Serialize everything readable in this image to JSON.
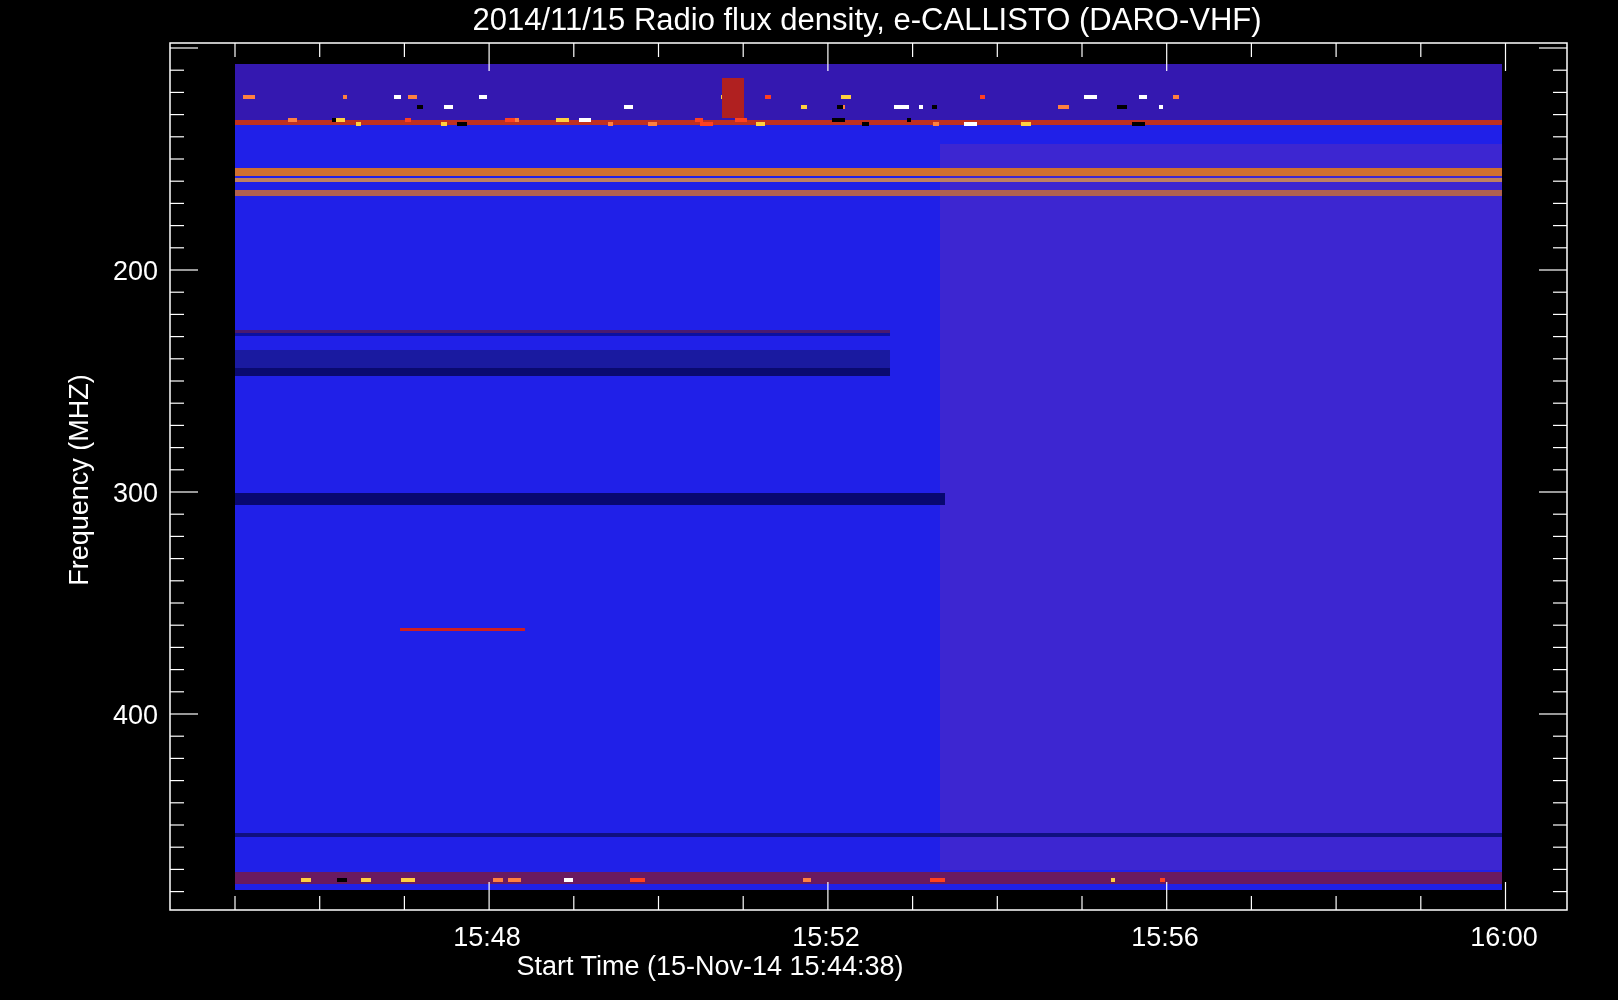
{
  "plot": {
    "title": "2014/11/15  Radio flux density, e-CALLISTO (DARO-VHF)",
    "ylabel": "Frequency (MHZ)",
    "yticks": [
      "200",
      "300",
      "400"
    ],
    "xticks": [
      "15:48",
      "15:52",
      "15:56",
      "16:00"
    ],
    "xlabel": "Start Time (15-Nov-14 15:44:38)"
  }
}
